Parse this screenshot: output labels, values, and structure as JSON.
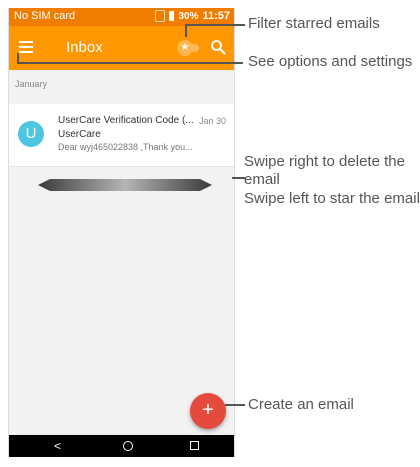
{
  "statusbar": {
    "carrier": "No SIM card",
    "battery": "30%",
    "time": "11:57"
  },
  "appbar": {
    "title": "Inbox",
    "menu_icon": "hamburger-menu-icon",
    "star_icon": "star-icon",
    "search_icon": "search-icon"
  },
  "mail": {
    "section_header": "January",
    "emails": [
      {
        "avatar_letter": "U",
        "subject": "UserCare Verification Code (...",
        "date": "Jan 30",
        "sender": "UserCare",
        "preview": "Dear wyj465022838 ,Thank you..."
      }
    ]
  },
  "fab": {
    "symbol": "+",
    "icon": "plus-icon"
  },
  "navbar": {
    "back_symbol": "<"
  },
  "callouts": {
    "filter": "Filter starred emails",
    "options": "See options and settings",
    "swipe_right": "Swipe right to delete the",
    "swipe_right_cont": "email",
    "swipe_left": "Swipe left to star the email",
    "create": "Create an email"
  },
  "colors": {
    "status_bar": "#f07c00",
    "app_bar": "#ff9800",
    "avatar": "#4dc6e0",
    "fab": "#e44b3c",
    "callout": "#555555"
  }
}
